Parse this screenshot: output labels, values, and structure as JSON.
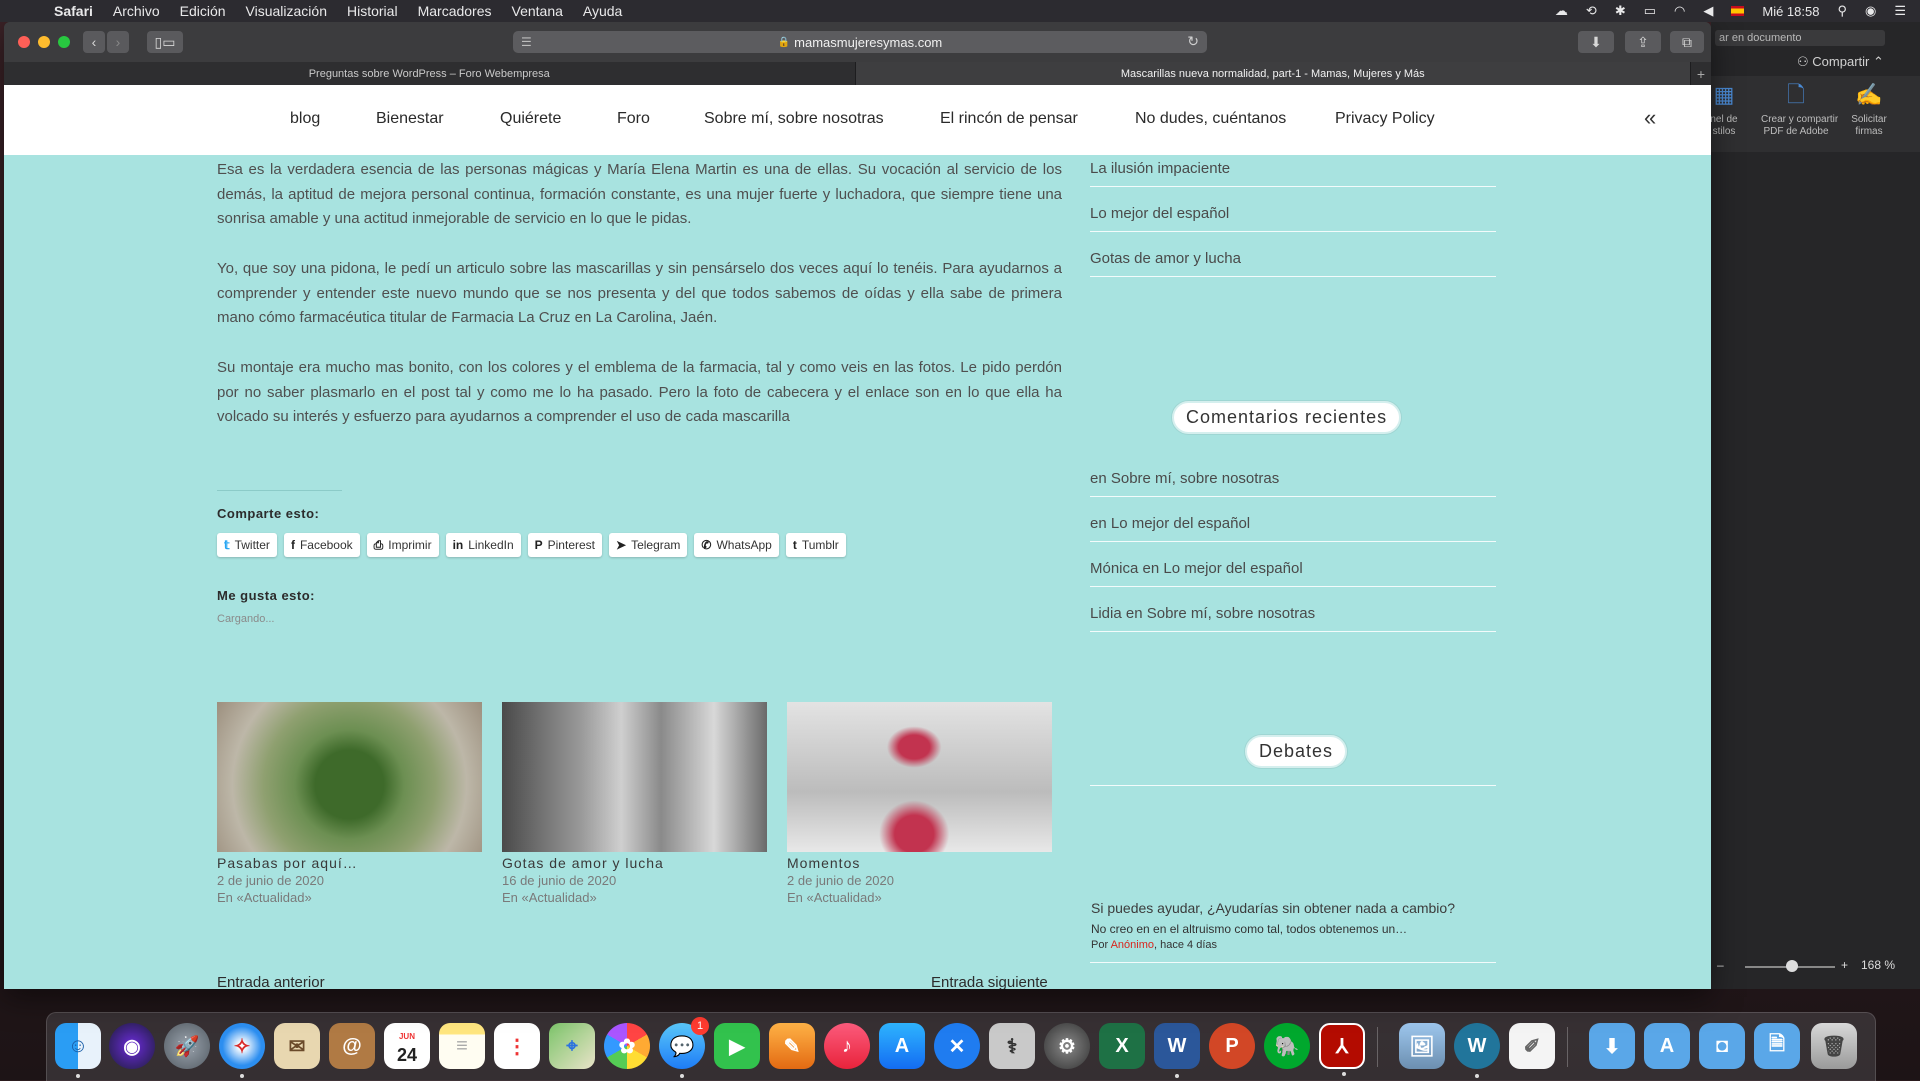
{
  "menubar": {
    "app": "Safari",
    "items": [
      "Archivo",
      "Edición",
      "Visualización",
      "Historial",
      "Marcadores",
      "Ventana",
      "Ayuda"
    ],
    "clock": "Mié 18:58"
  },
  "browser": {
    "url": "mamasmujeresymas.com",
    "tabs": [
      "Preguntas sobre WordPress – Foro Webempresa",
      "Mascarillas nueva normalidad, part-1 - Mamas, Mujeres y Más"
    ]
  },
  "nav": {
    "items": [
      "blog",
      "Bienestar",
      "Quiérete",
      "Foro",
      "Sobre mí, sobre nosotras",
      "El rincón de pensar",
      "No dudes, cuéntanos",
      "Privacy Policy"
    ],
    "collapse": "«"
  },
  "article": {
    "paragraphs": [
      "Esa es la verdadera esencia de las personas mágicas y María Elena Martin es una de ellas. Su vocación al servicio de los demás, la aptitud de mejora personal continua, formación constante, es una mujer fuerte y luchadora, que siempre tiene una sonrisa amable y una actitud inmejorable de servicio en lo que le pidas.",
      "Yo, que soy una pidona, le pedí un articulo sobre las mascarillas y sin pensárselo dos veces aquí lo tenéis. Para ayudarnos a comprender y entender este nuevo mundo que se nos presenta y del que todos sabemos de oídas y ella sabe de primera mano cómo farmacéutica titular de Farmacia La Cruz en La Carolina, Jaén.",
      "Su montaje era mucho mas bonito, con los colores y el emblema de la farmacia, tal y como veis en las fotos. Le pido perdón por no saber plasmarlo en el post tal y como me lo ha pasado. Pero la foto de cabecera y el enlace son en lo que ella ha volcado su interés y esfuerzo para ayudarnos a comprender el uso de cada mascarilla"
    ],
    "share_title": "Comparte esto:",
    "share_buttons": [
      {
        "label": "Twitter",
        "icon": "twitter-icon"
      },
      {
        "label": "Facebook",
        "icon": "facebook-icon"
      },
      {
        "label": "Imprimir",
        "icon": "print-icon"
      },
      {
        "label": "LinkedIn",
        "icon": "linkedin-icon"
      },
      {
        "label": "Pinterest",
        "icon": "pinterest-icon"
      },
      {
        "label": "Telegram",
        "icon": "telegram-icon"
      },
      {
        "label": "WhatsApp",
        "icon": "whatsapp-icon"
      },
      {
        "label": "Tumblr",
        "icon": "tumblr-icon"
      }
    ],
    "like_title": "Me gusta esto:",
    "loading": "Cargando...",
    "related": [
      {
        "title": "Pasabas por aquí…",
        "date": "2 de junio de 2020",
        "category": "En «Actualidad»"
      },
      {
        "title": "Gotas de amor y lucha",
        "date": "16 de junio de 2020",
        "category": "En «Actualidad»"
      },
      {
        "title": "Momentos",
        "date": "2 de junio de 2020",
        "category": "En «Actualidad»"
      }
    ],
    "prev": "Entrada anterior",
    "next": "Entrada siguiente"
  },
  "sidebar": {
    "recent_posts": [
      "La ilusión impaciente",
      "Lo mejor del español",
      "Gotas de amor y lucha"
    ],
    "comments_title": "Comentarios recientes",
    "comments": [
      {
        "author": "",
        "prep": "en",
        "post": "Sobre mí, sobre nosotras"
      },
      {
        "author": "",
        "prep": "en",
        "post": "Lo mejor del español"
      },
      {
        "author": "Mónica",
        "prep": "en",
        "post": "Lo mejor del español"
      },
      {
        "author": "Lidia",
        "prep": "en",
        "post": "Sobre mí, sobre nosotras"
      }
    ],
    "debates_title": "Debates",
    "debate": {
      "question": "Si puedes ayudar, ¿Ayudarías sin obtener nada a cambio?",
      "text": "No creo en en el altruismo como tal, todos obtenemos un…",
      "by": "Por",
      "author": "Anónimo",
      "when": ", hace 4 días"
    }
  },
  "acrobat": {
    "search_placeholder": "ar en documento",
    "share": "Compartir",
    "tools": [
      "nel de\nstilos",
      "Crear y compartir\nPDF de Adobe",
      "Solicitar\nfirmas"
    ],
    "zoom": "168 %"
  },
  "dock": {
    "calendar_month": "JUN",
    "calendar_day": "24",
    "messages_badge": "1"
  }
}
